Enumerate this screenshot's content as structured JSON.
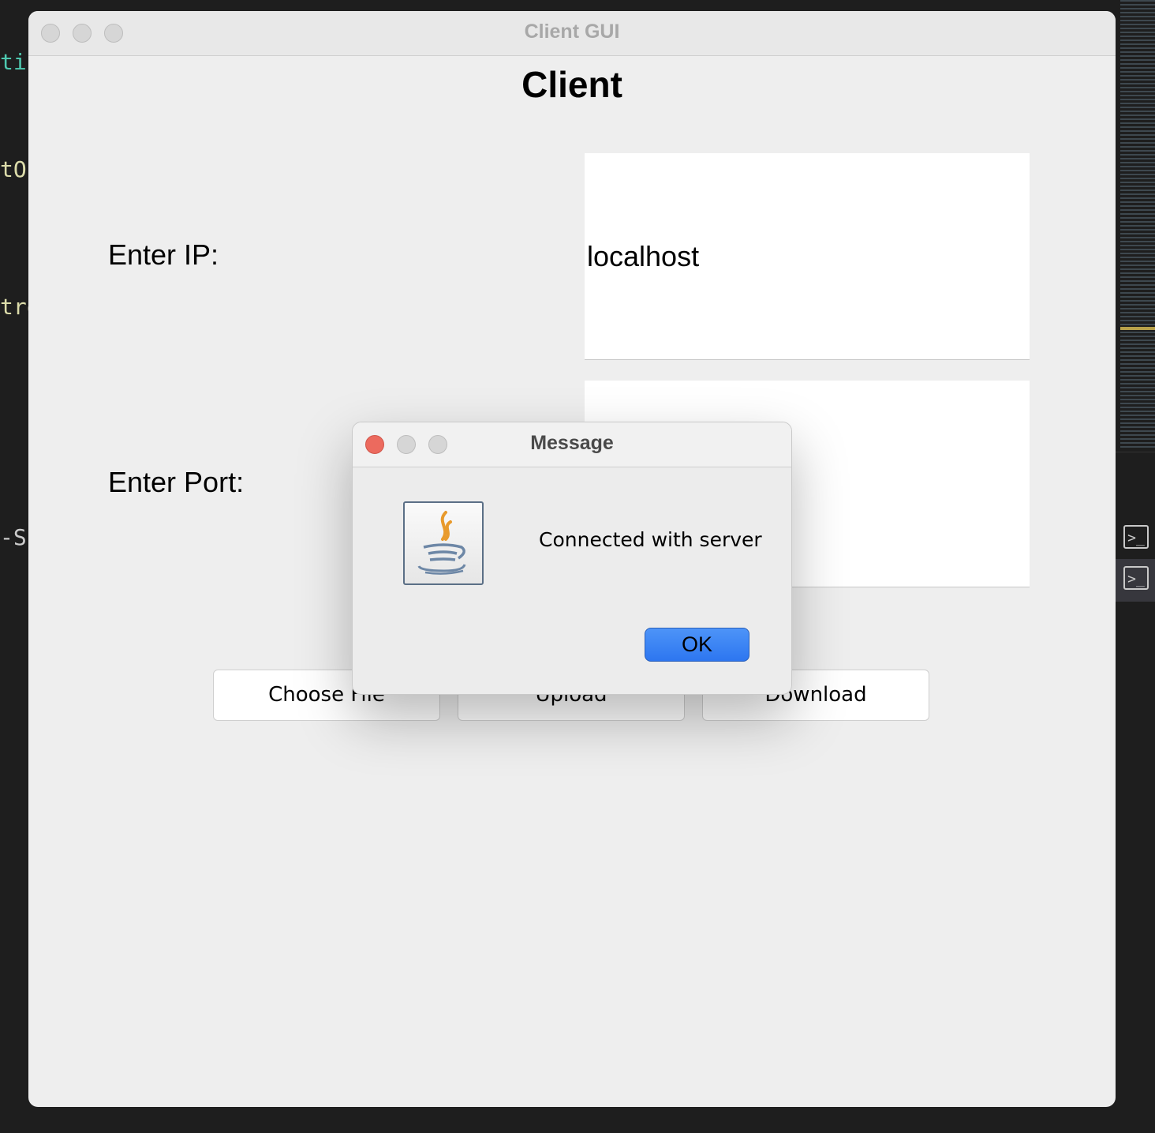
{
  "background_editor": {
    "code_fragments": [
      "tic",
      "tOu",
      "tro",
      "-S"
    ],
    "terminal_icon_glyph": ">_"
  },
  "window": {
    "title": "Client GUI",
    "heading": "Client",
    "ip_label": "Enter IP:",
    "ip_value": "localhost",
    "port_label": "Enter Port:",
    "port_value": "",
    "buttons": {
      "choose_file": "Choose File",
      "upload": "Upload",
      "download": "Download"
    }
  },
  "dialog": {
    "title": "Message",
    "icon": "java-icon",
    "message": "Connected with server",
    "ok_label": "OK",
    "accent": "#3b82f6",
    "close_color": "#ec6a5e"
  }
}
